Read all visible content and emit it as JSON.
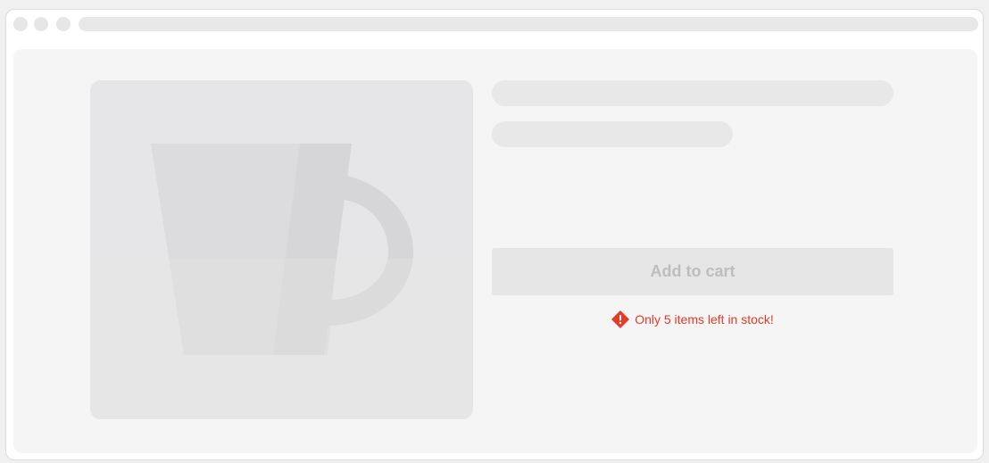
{
  "window": {
    "titlebar_dots": 3
  },
  "product": {
    "image_icon": "coffee-mug-icon",
    "title_placeholder": "",
    "subtitle_placeholder": ""
  },
  "cart": {
    "button_label": "Add to cart",
    "button_state": "disabled"
  },
  "stock": {
    "icon": "warning-diamond-icon",
    "message": "Only 5 items left in stock!"
  },
  "colors": {
    "warning": "#e23b26",
    "skeleton": "#e8e8e8",
    "button_bg": "#e6e6e6",
    "button_text": "#bdbdbd"
  }
}
